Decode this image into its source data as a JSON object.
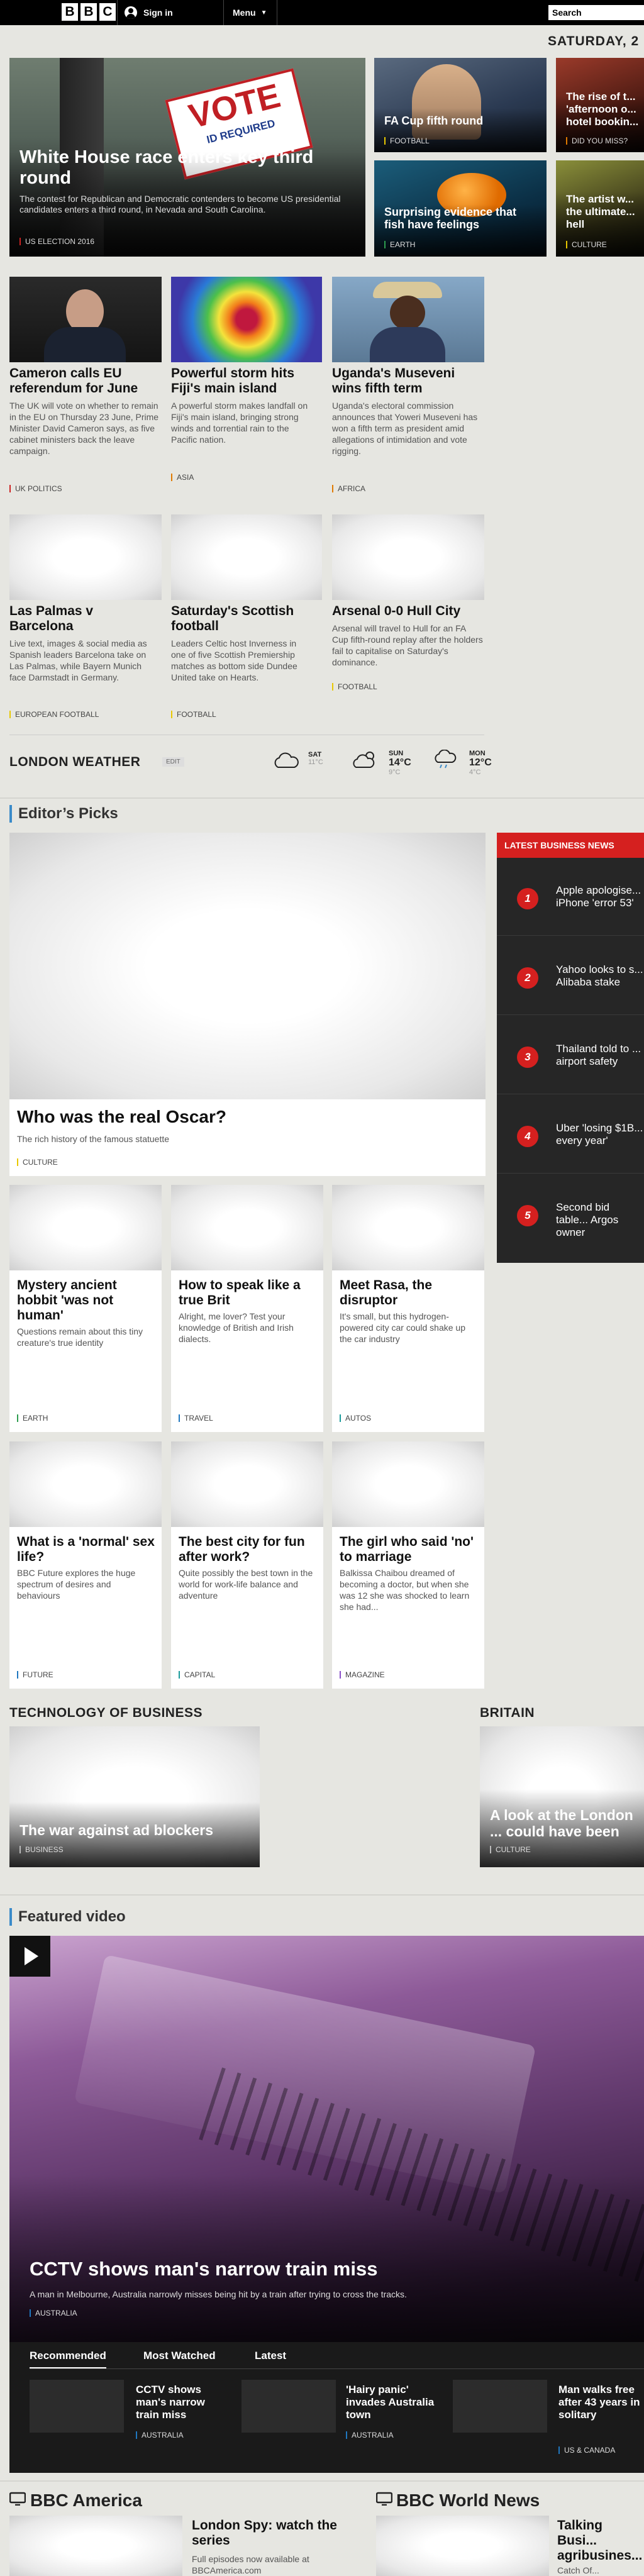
{
  "header": {
    "logo_letters": [
      "B",
      "B",
      "C"
    ],
    "signin_label": "Sign in",
    "menu_label": "Menu",
    "search_label": "Search"
  },
  "date": "SATURDAY, 2",
  "hero": {
    "main": {
      "sign_line1": "VOTE",
      "sign_line2": "ID REQUIRED",
      "title": "White House race enters key third round",
      "summary": "The contest for Republican and Democratic contenders to become US presidential candidates enters a third round, in Nevada and South Carolina.",
      "tag": "US ELECTION 2016"
    },
    "tiles": [
      {
        "title": "FA Cup fifth round",
        "tag": "FOOTBALL"
      },
      {
        "title": "The rise of t... 'afternoon o... hotel bookin...",
        "tag": "DID YOU MISS?"
      },
      {
        "title": "Surprising evidence that fish have feelings",
        "tag": "EARTH"
      },
      {
        "title": "The artist w... the ultimate... hell",
        "tag": "CULTURE"
      }
    ]
  },
  "stories1": [
    {
      "title": "Cameron calls EU referendum for June",
      "body": "The UK will vote on whether to remain in the EU on Thursday 23 June, Prime Minister David Cameron says, as five cabinet ministers back the leave campaign.",
      "tag": "UK POLITICS"
    },
    {
      "title": "Powerful storm hits Fiji's main island",
      "body": "A powerful storm makes landfall on Fiji's main island, bringing strong winds and torrential rain to the Pacific nation.",
      "tag": "ASIA"
    },
    {
      "title": "Uganda's Museveni wins fifth term",
      "body": "Uganda's electoral commission announces that Yoweri Museveni has won a fifth term as president amid allegations of intimidation and vote rigging.",
      "tag": "AFRICA"
    }
  ],
  "stories2": [
    {
      "title": "Las Palmas v Barcelona",
      "body": "Live text, images & social media as Spanish leaders Barcelona take on Las Palmas, while Bayern Munich face Darmstadt in Germany.",
      "tag": "EUROPEAN FOOTBALL"
    },
    {
      "title": "Saturday's Scottish football",
      "body": "Leaders Celtic host Inverness in one of five Scottish Premiership matches as bottom side Dundee United take on Hearts.",
      "tag": "FOOTBALL"
    },
    {
      "title": "Arsenal 0-0 Hull City",
      "body": "Arsenal will travel to Hull for an FA Cup fifth-round replay after the holders fail to capitalise on Saturday's dominance.",
      "tag": "FOOTBALL"
    }
  ],
  "weather": {
    "title": "LONDON WEATHER",
    "edit": "EDIT",
    "days": [
      {
        "day": "SAT",
        "high": "11°C",
        "low": ""
      },
      {
        "day": "SUN",
        "high": "14°C",
        "low": "9°C"
      },
      {
        "day": "MON",
        "high": "12°C",
        "low": "4°C"
      }
    ]
  },
  "editors": {
    "title": "Editor’s Picks",
    "feature": {
      "title": "Who was the real Oscar?",
      "body": "The rich history of the famous statuette",
      "tag": "CULTURE"
    },
    "row1": [
      {
        "title": "Mystery ancient hobbit 'was not human'",
        "body": "Questions remain about this tiny creature's true identity",
        "tag": "EARTH"
      },
      {
        "title": "How to speak like a true Brit",
        "body": "Alright, me lover? Test your knowledge of British and Irish dialects.",
        "tag": "TRAVEL"
      },
      {
        "title": "Meet Rasa, the disruptor",
        "body": "It's small, but this hydrogen-powered city car could shake up the car industry",
        "tag": "AUTOS"
      }
    ],
    "row2": [
      {
        "title": "What is a 'normal' sex life?",
        "body": "BBC Future explores the huge spectrum of desires and behaviours",
        "tag": "FUTURE"
      },
      {
        "title": "The best city for fun after work?",
        "body": "Quite possibly the best town in the world for work-life balance and adventure",
        "tag": "CAPITAL"
      },
      {
        "title": "The girl who said 'no' to marriage",
        "body": "Balkissa Chaibou dreamed of becoming a doctor, but when she was 12 she was shocked to learn she had...",
        "tag": "MAGAZINE"
      }
    ]
  },
  "business": {
    "header": "LATEST BUSINESS NEWS",
    "items": [
      {
        "num": "1",
        "text": "Apple apologise... iPhone 'error 53'"
      },
      {
        "num": "2",
        "text": "Yahoo looks to s... Alibaba stake"
      },
      {
        "num": "3",
        "text": "Thailand told to ... airport safety"
      },
      {
        "num": "4",
        "text": "Uber 'losing $1B... every year'"
      },
      {
        "num": "5",
        "text": "Second bid table... Argos owner"
      }
    ]
  },
  "tech": {
    "title": "TECHNOLOGY OF BUSINESS",
    "card_title": "The war against ad blockers",
    "tag": "BUSINESS"
  },
  "britain": {
    "title": "BRITAIN",
    "card_title": "A look at the London ... could have been",
    "tag": "CULTURE"
  },
  "video": {
    "title": "Featured video",
    "headline": "CCTV shows man's narrow train miss",
    "summary": "A man in Melbourne, Australia narrowly misses being hit by a train after trying to cross the tracks.",
    "tag": "AUSTRALIA",
    "tabs": [
      "Recommended",
      "Most Watched",
      "Latest"
    ],
    "items": [
      {
        "title": "CCTV shows man's narrow train miss",
        "tag": "AUSTRALIA"
      },
      {
        "title": "'Hairy panic' invades Australia town",
        "tag": "AUSTRALIA"
      },
      {
        "title": "Man walks free after 43 years in solitary",
        "tag": "US & CANADA"
      }
    ]
  },
  "america": {
    "title": "BBC America",
    "card_title": "London Spy: watch the series",
    "body": "Full episodes now available at BBCAmerica.com"
  },
  "worldnews": {
    "title": "BBC World News",
    "card_title": "Talking Busi... agribusines... help Austr...",
    "body": "Catch Of..."
  },
  "colors": {
    "accent_red": "#d5201f",
    "blue_section": "#3b8bc9",
    "header_bg": "#000000"
  }
}
